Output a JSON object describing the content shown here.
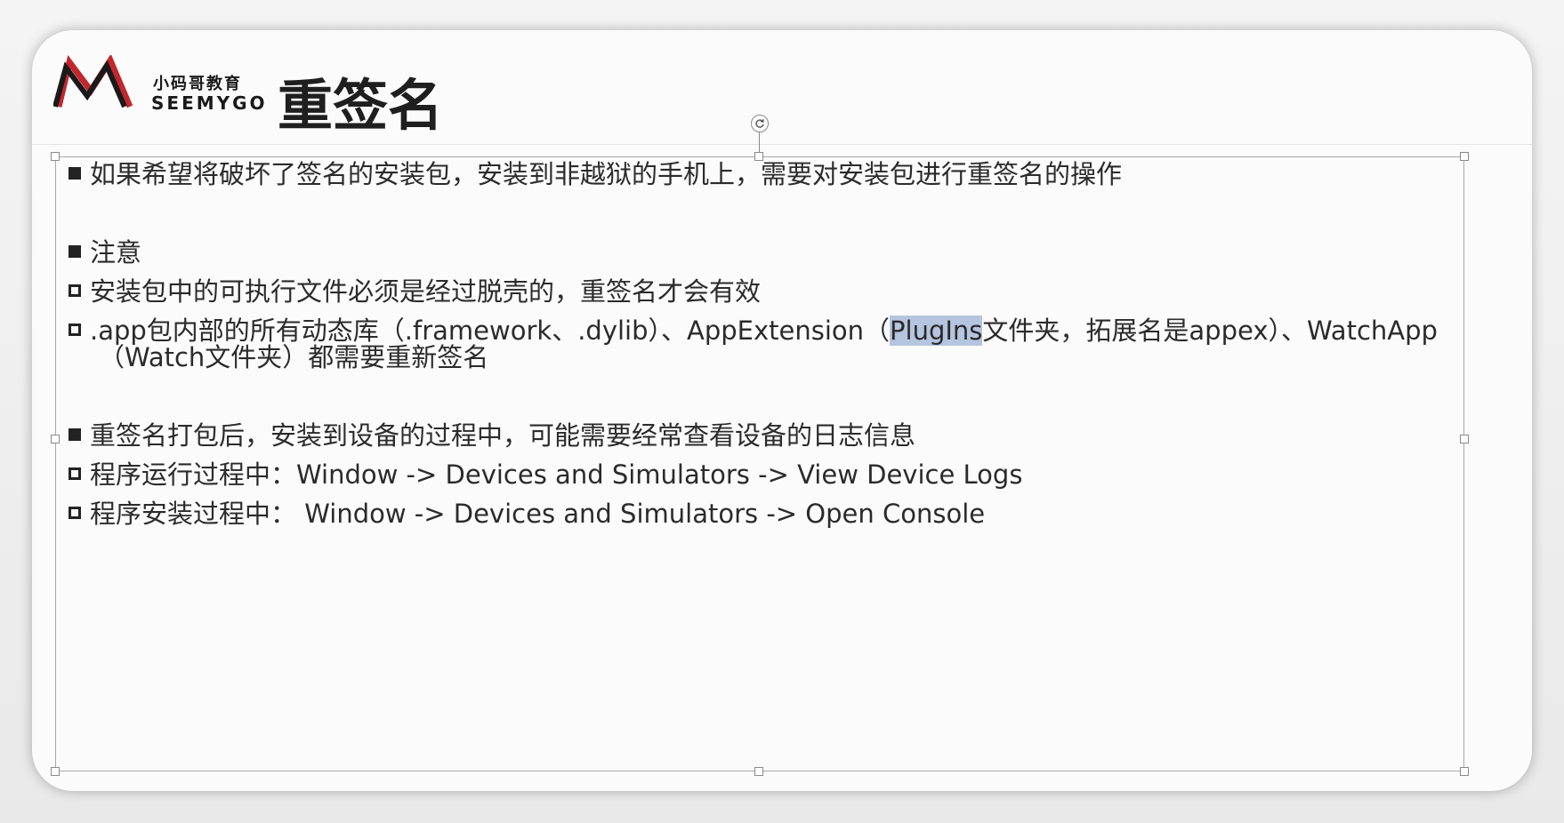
{
  "header": {
    "logo_cn": "小码哥教育",
    "logo_en": "SEEMYGO",
    "logo_colors": {
      "red": "#c2272d",
      "dark": "#1a1a1a"
    },
    "title": "重签名"
  },
  "content": {
    "item1": "如果希望将破坏了签名的安装包，安装到非越狱的手机上，需要对安装包进行重签名的操作",
    "item2": "注意",
    "item2_sub1": "安装包中的可执行文件必须是经过脱壳的，重签名才会有效",
    "item2_sub2_before": ".app包内部的所有动态库（.framework、.dylib）、AppExtension（",
    "item2_sub2_highlight": "PlugIns",
    "item2_sub2_after": "文件夹，拓展名是appex）、WatchApp",
    "item2_sub2_line2": "（Watch文件夹）都需要重新签名",
    "item3": "重签名打包后，安装到设备的过程中，可能需要经常查看设备的日志信息",
    "item3_sub1": "程序运行过程中：Window -> Devices and Simulators -> View Device Logs",
    "item3_sub2": "程序安装过程中： Window -> Devices and Simulators -> Open Console",
    "highlight_color": "#b5c5df"
  }
}
